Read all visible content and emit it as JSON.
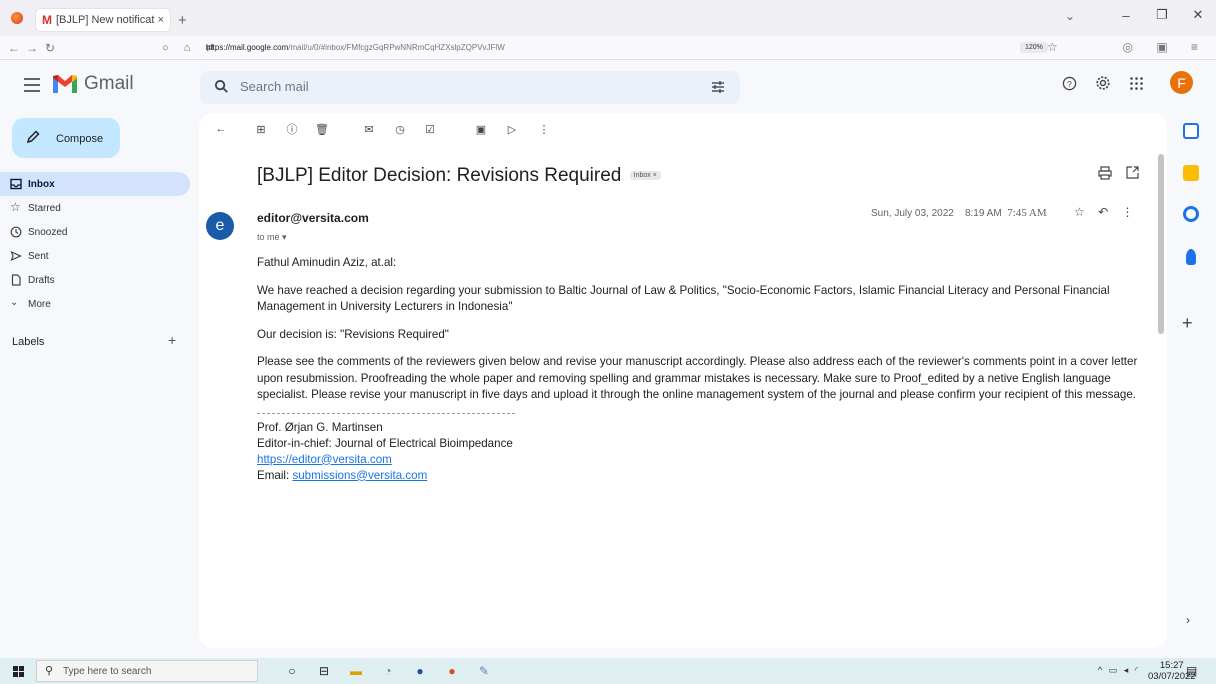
{
  "browser": {
    "tab_title": "[BJLP] New notification",
    "url_host": "https://mail.google.com",
    "url_path": "/mail/u/0/#inbox/FMfcgzGqRPwNNRmCqHZXslpZQPVvJFlW",
    "zoom": "120%"
  },
  "gmail": {
    "brand": "Gmail",
    "search_placeholder": "Search mail",
    "avatar_letter": "F"
  },
  "nav": {
    "compose_label": "Compose",
    "items": [
      {
        "label": "Inbox",
        "icon": "inbox-icon",
        "active": true
      },
      {
        "label": "Starred",
        "icon": "star-icon",
        "active": false
      },
      {
        "label": "Snoozed",
        "icon": "clock-icon",
        "active": false
      },
      {
        "label": "Sent",
        "icon": "send-icon",
        "active": false
      },
      {
        "label": "Drafts",
        "icon": "draft-icon",
        "active": false
      },
      {
        "label": "More",
        "icon": "chevron-down-icon",
        "active": false
      }
    ],
    "labels_header": "Labels"
  },
  "message": {
    "subject": "[BJLP] Editor Decision: Revisions Required",
    "label_chip": "Inbox ×",
    "sender": "editor@versita.com",
    "sender_initial": "e",
    "to": "to me ▾",
    "date": "Sun, July 03, 2022",
    "time1": "8:19 AM",
    "time2": "7:45 AM",
    "greeting": "Fathul Aminudin Aziz, at.al:",
    "p1": "We have reached a decision regarding your submission to Baltic Journal of Law & Politics, \"Socio-Economic Factors, Islamic Financial Literacy and Personal Financial Management in University Lecturers in Indonesia\"",
    "decision": "Our decision is: \"Revisions Required\"",
    "p2": "Please see the comments of the reviewers given below and revise your manuscript accordingly. Please also address each of the reviewer's comments point in a cover letter upon resubmission. Proofreading the whole paper and removing spelling and grammar mistakes is necessary. Make sure to Proof_edited by a netive English language specialist. Please revise your manuscript in five days and upload it through the online management system of the journal and please confirm your recipient of this message.",
    "sig_name": "Prof. Ørjan G. Martinsen",
    "sig_title": "Editor-in-chief: Journal of Electrical Bioimpedance",
    "sig_link": "https://editor@versita.com",
    "sig_email_label": "Email: ",
    "sig_email": "submissions@versita.com"
  },
  "taskbar": {
    "search_placeholder": "Type here to search",
    "time": "15:27",
    "date": "03/07/2022"
  },
  "colors": {
    "compose_bg": "#c2e7ff",
    "active_nav": "#d3e3fd",
    "search_bg": "#eaf1fb",
    "avatar": "#e8710a",
    "sender_avatar": "#1a5aa8",
    "link": "#1a73e8"
  }
}
